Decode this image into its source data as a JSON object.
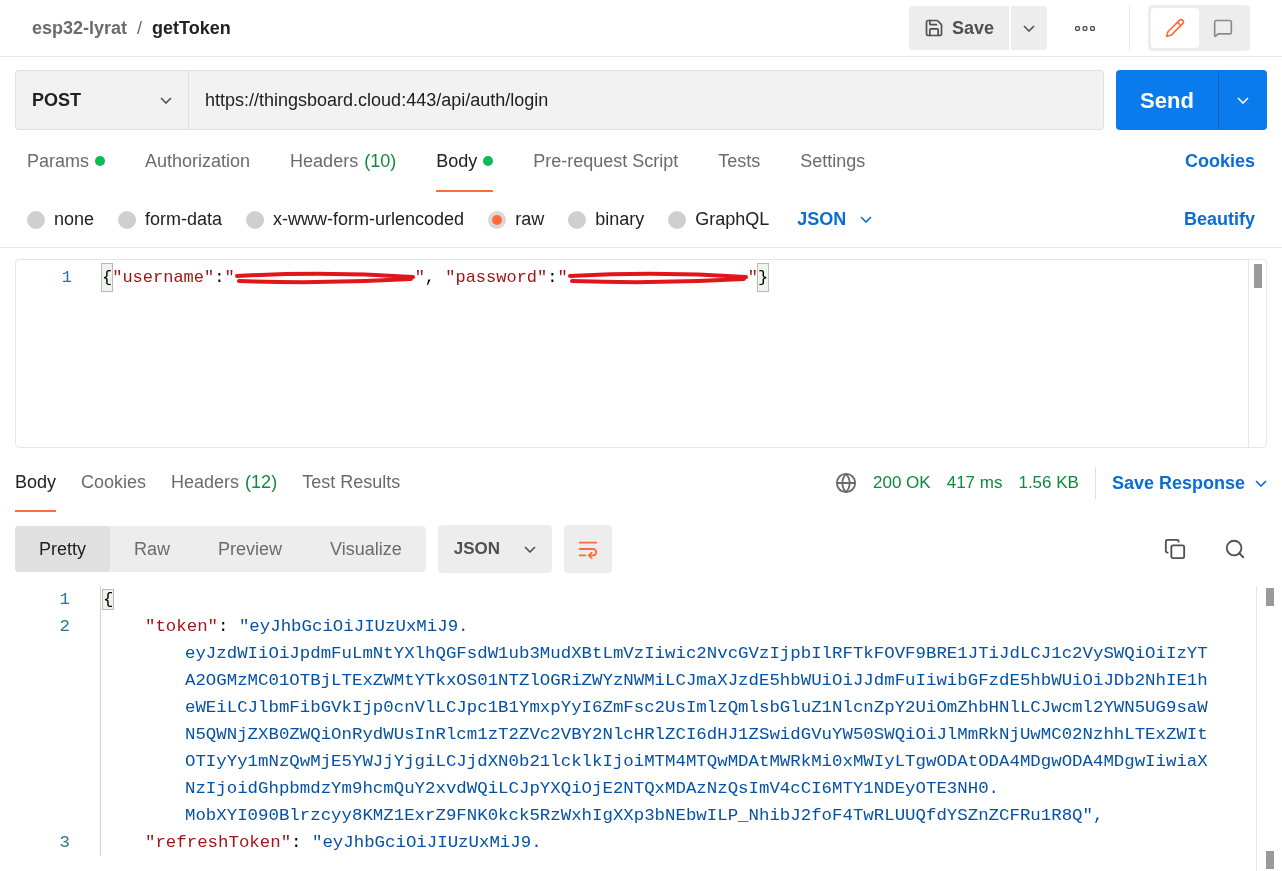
{
  "breadcrumb": {
    "collection": "esp32-lyrat",
    "separator": "/",
    "request": "getToken"
  },
  "save": {
    "label": "Save"
  },
  "mode_buttons": [
    {
      "kind": "edit",
      "selected": true
    },
    {
      "kind": "comment",
      "selected": false
    }
  ],
  "request": {
    "method": "POST",
    "url": "https://thingsboard.cloud:443/api/auth/login",
    "send": "Send"
  },
  "request_tabs": [
    {
      "label": "Params",
      "dot": true,
      "selected": false
    },
    {
      "label": "Authorization",
      "dot": false,
      "selected": false
    },
    {
      "label": "Headers",
      "count": "(10)",
      "dot": false,
      "selected": false
    },
    {
      "label": "Body",
      "dot": true,
      "selected": true
    },
    {
      "label": "Pre-request Script",
      "dot": false,
      "selected": false
    },
    {
      "label": "Tests",
      "dot": false,
      "selected": false
    },
    {
      "label": "Settings",
      "dot": false,
      "selected": false
    }
  ],
  "cookies_link": "Cookies",
  "body_types": [
    {
      "label": "none",
      "selected": false
    },
    {
      "label": "form-data",
      "selected": false
    },
    {
      "label": "x-www-form-urlencoded",
      "selected": false
    },
    {
      "label": "raw",
      "selected": true
    },
    {
      "label": "binary",
      "selected": false
    },
    {
      "label": "GraphQL",
      "selected": false
    }
  ],
  "body_format": "JSON",
  "beautify": "Beautify",
  "request_body": {
    "lines": [
      {
        "number": "1",
        "segments": [
          {
            "kind": "brace",
            "text": "{"
          },
          {
            "kind": "key",
            "text": "\"username\""
          },
          {
            "kind": "punct",
            "text": ":"
          },
          {
            "kind": "string",
            "text": "\""
          },
          {
            "kind": "redacted"
          },
          {
            "kind": "string",
            "text": "\""
          },
          {
            "kind": "punct",
            "text": ", "
          },
          {
            "kind": "key",
            "text": "\"password\""
          },
          {
            "kind": "punct",
            "text": ":"
          },
          {
            "kind": "string",
            "text": "\""
          },
          {
            "kind": "redacted"
          },
          {
            "kind": "string",
            "text": "\""
          },
          {
            "kind": "brace",
            "text": "}"
          }
        ]
      }
    ]
  },
  "response_tabs": [
    {
      "label": "Body",
      "selected": true
    },
    {
      "label": "Cookies",
      "selected": false
    },
    {
      "label": "Headers",
      "count": "(12)",
      "selected": false
    },
    {
      "label": "Test Results",
      "selected": false
    }
  ],
  "response_status": {
    "status": "200 OK",
    "time": "417 ms",
    "size": "1.56 KB"
  },
  "save_response": "Save Response",
  "view_tabs": [
    {
      "label": "Pretty",
      "selected": true
    },
    {
      "label": "Raw",
      "selected": false
    },
    {
      "label": "Preview",
      "selected": false
    },
    {
      "label": "Visualize",
      "selected": false
    }
  ],
  "response_format": "JSON",
  "response_body": {
    "lines": [
      {
        "number": "1",
        "kind": "brace",
        "text": "{"
      },
      {
        "number": "2",
        "kind": "pair",
        "key": "\"token\"",
        "colon": ":",
        "value_lines": [
          "\"eyJhbGciOiJIUzUxMiJ9.",
          "eyJzdWIiOiJpdmFuLmNtYXlhQGFsdW1ub3MudXBtLmVzIiwic2NvcGVzIjpbIlRFTkFOVF9BRE1JTiJdLCJ1c2VySWQiOiIzYT",
          "A2OGMzMC01OTBjLTExZWMtYTkxOS01NTZlOGRiZWYzNWMiLCJmaXJzdE5hbWUiOiJJdmFuIiwibGFzdE5hbWUiOiJDb2NhIE1h",
          "eWEiLCJlbmFibGVkIjp0cnVlLCJpc1B1YmxpYyI6ZmFsc2UsImlzQmlsbGluZ1NlcnZpY2UiOmZhbHNlLCJwcml2YWN5UG9saW",
          "N5QWNjZXB0ZWQiOnRydWUsInRlcm1zT2ZVc2VBY2NlcHRlZCI6dHJ1ZSwidGVuYW50SWQiOiJlMmRkNjUwMC02NzhhLTExZWIt",
          "OTIyYy1mNzQwMjE5YWJjYjgiLCJjdXN0b21lcklkIjoiMTM4MTQwMDAtMWRkMi0xMWIyLTgwODAtODA4MDgwODA4MDgwIiwiaX",
          "NzIjoidGhpbmdzYm9hcmQuY2xvdWQiLCJpYXQiOjE2NTQxMDAzNzQsImV4cCI6MTY1NDEyOTE3NH0.",
          "MobXYI090Blrzcyy8KMZ1ExrZ9FNK0kck5RzWxhIgXXp3bNEbwILP_NhibJ2foF4TwRLUUQfdYSZnZCFRu1R8Q\","
        ]
      },
      {
        "number": "3",
        "kind": "pair",
        "key": "\"refreshToken\"",
        "colon": ":",
        "value_lines": [
          "\"eyJhbGciOiJIUzUxMiJ9."
        ]
      }
    ]
  }
}
